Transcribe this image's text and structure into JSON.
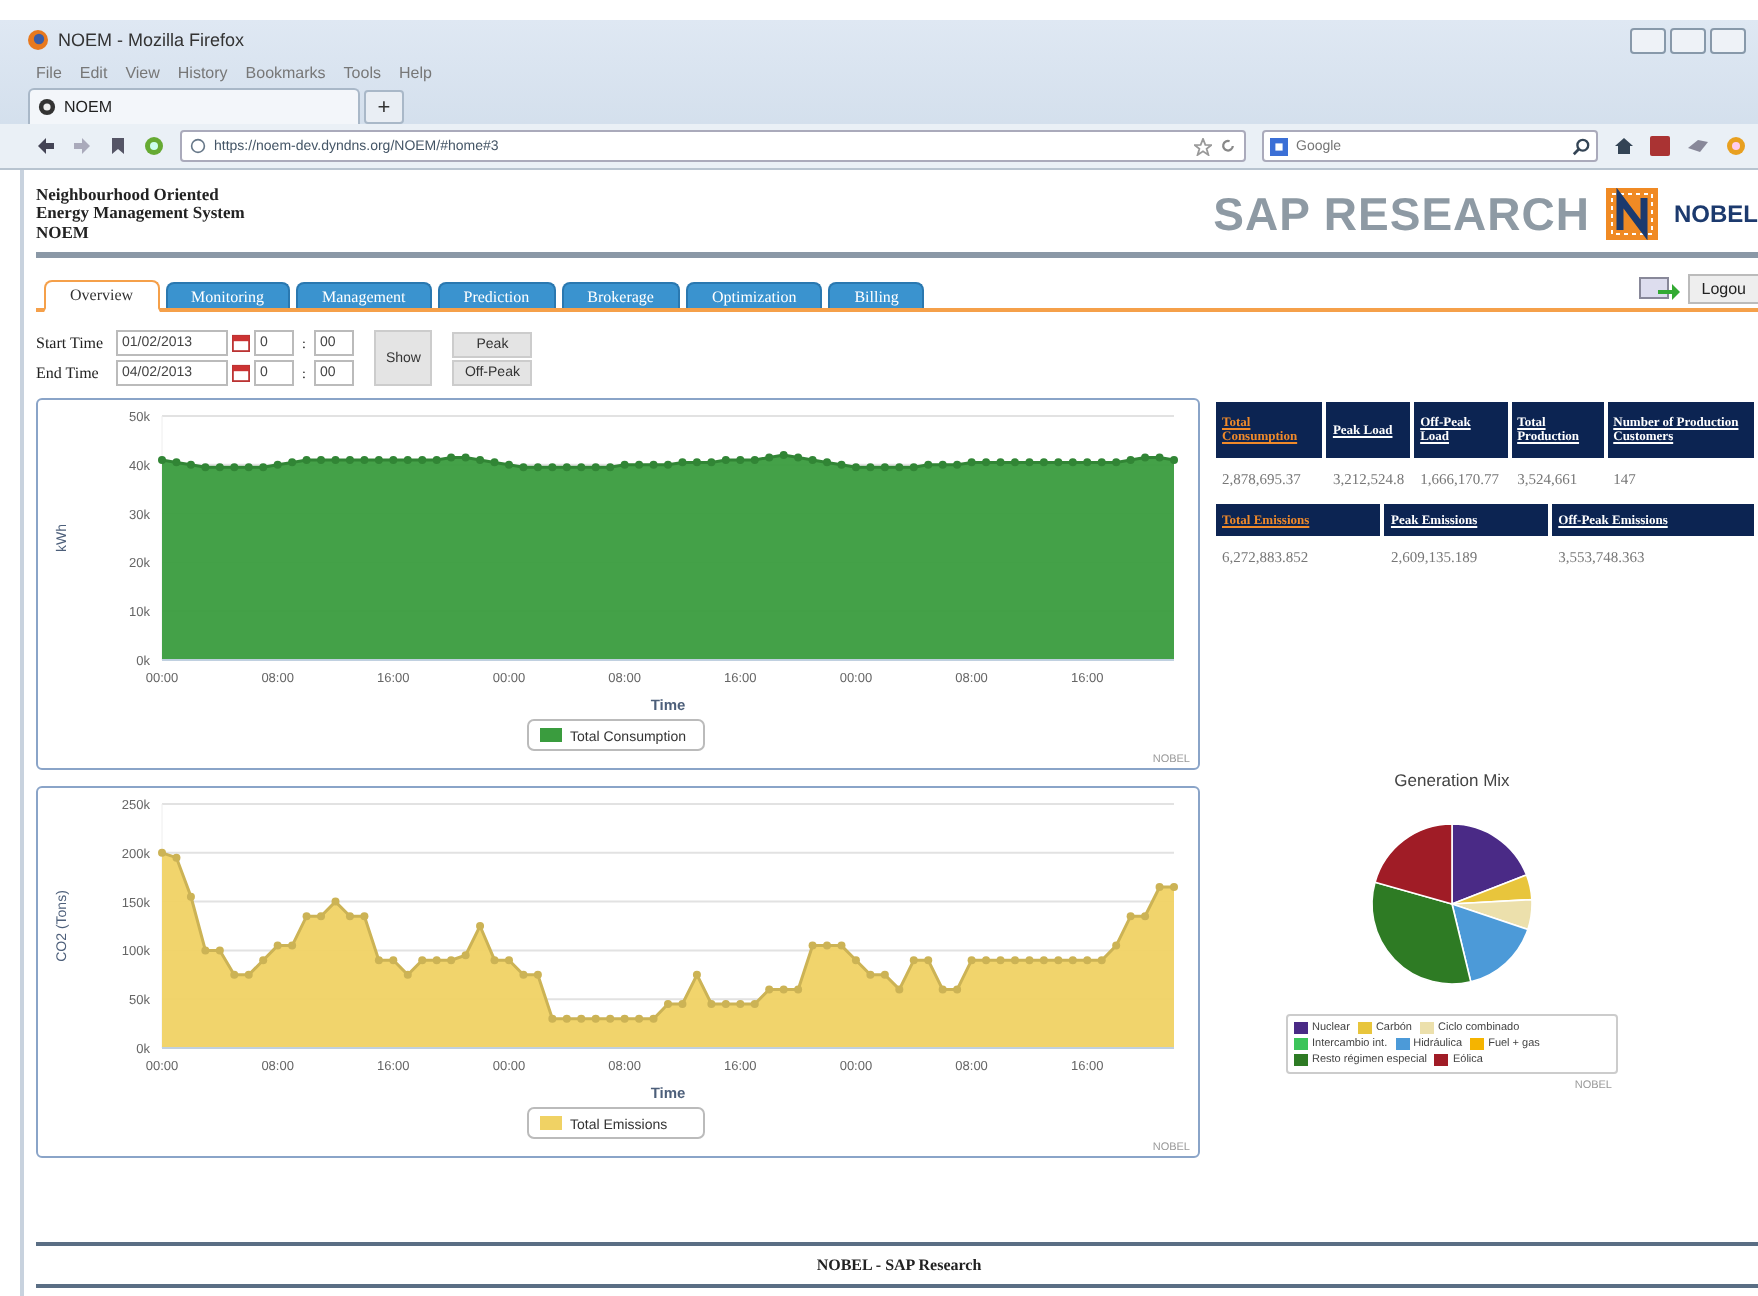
{
  "browser": {
    "title": "NOEM - Mozilla Firefox",
    "menu": [
      "File",
      "Edit",
      "View",
      "History",
      "Bookmarks",
      "Tools",
      "Help"
    ],
    "tab": {
      "label": "NOEM"
    },
    "new_tab": "+",
    "url": "https://noem-dev.dyndns.org/NOEM/#home#3",
    "search": {
      "placeholder": "Google"
    }
  },
  "header": {
    "title_lines": [
      "Neighbourhood Oriented",
      "Energy Management System",
      "NOEM"
    ],
    "logo_text": "SAP RESEARCH",
    "partner_logo": "NOBEL"
  },
  "tabs": [
    {
      "label": "Overview",
      "selected": true
    },
    {
      "label": "Monitoring",
      "selected": false
    },
    {
      "label": "Management",
      "selected": false
    },
    {
      "label": "Prediction",
      "selected": false
    },
    {
      "label": "Brokerage",
      "selected": false
    },
    {
      "label": "Optimization",
      "selected": false
    },
    {
      "label": "Billing",
      "selected": false
    }
  ],
  "logout": "Logou",
  "filters": [
    {
      "label": "Start Time",
      "date": "01/02/2013",
      "hour": "0",
      "separator": ":",
      "minute": "00"
    },
    {
      "label": "End Time",
      "date": "04/02/2013",
      "hour": "0",
      "separator": ":",
      "minute": "00"
    }
  ],
  "show_button": "Show",
  "peak_buttons": [
    "Peak",
    "Off-Peak"
  ],
  "charts": [
    {
      "credit": "NOBEL",
      "chart_data": {
        "type": "area",
        "xlabel": "Time",
        "ylabel": "kWh",
        "grid": true,
        "legend": true,
        "x": [
          "2013-02-01T00:00",
          "2013-02-01T01:00",
          "2013-02-01T02:00",
          "2013-02-01T03:00",
          "2013-02-01T04:00",
          "2013-02-01T05:00",
          "2013-02-01T06:00",
          "2013-02-01T07:00",
          "2013-02-01T08:00",
          "2013-02-01T09:00",
          "2013-02-01T10:00",
          "2013-02-01T11:00",
          "2013-02-01T12:00",
          "2013-02-01T13:00",
          "2013-02-01T14:00",
          "2013-02-01T15:00",
          "2013-02-01T16:00",
          "2013-02-01T17:00",
          "2013-02-01T18:00",
          "2013-02-01T19:00",
          "2013-02-01T20:00",
          "2013-02-01T21:00",
          "2013-02-01T22:00",
          "2013-02-01T23:00",
          "2013-02-02T00:00",
          "2013-02-02T01:00",
          "2013-02-02T02:00",
          "2013-02-02T03:00",
          "2013-02-02T04:00",
          "2013-02-02T05:00",
          "2013-02-02T06:00",
          "2013-02-02T07:00",
          "2013-02-02T08:00",
          "2013-02-02T09:00",
          "2013-02-02T10:00",
          "2013-02-02T11:00",
          "2013-02-02T12:00",
          "2013-02-02T13:00",
          "2013-02-02T14:00",
          "2013-02-02T15:00",
          "2013-02-02T16:00",
          "2013-02-02T17:00",
          "2013-02-02T18:00",
          "2013-02-02T19:00",
          "2013-02-02T20:00",
          "2013-02-02T21:00",
          "2013-02-02T22:00",
          "2013-02-02T23:00",
          "2013-02-03T00:00",
          "2013-02-03T01:00",
          "2013-02-03T02:00",
          "2013-02-03T03:00",
          "2013-02-03T04:00",
          "2013-02-03T05:00",
          "2013-02-03T06:00",
          "2013-02-03T07:00",
          "2013-02-03T08:00",
          "2013-02-03T09:00",
          "2013-02-03T10:00",
          "2013-02-03T11:00",
          "2013-02-03T12:00",
          "2013-02-03T13:00",
          "2013-02-03T14:00",
          "2013-02-03T15:00",
          "2013-02-03T16:00",
          "2013-02-03T17:00",
          "2013-02-03T18:00",
          "2013-02-03T19:00",
          "2013-02-03T20:00",
          "2013-02-03T21:00",
          "2013-02-03T22:00"
        ],
        "xlim": [
          "2013-02-01T00:00",
          "2013-02-03T22:00"
        ],
        "ylim": [
          0,
          50000
        ],
        "yticks": [
          {
            "value": 0,
            "label": "0k"
          },
          {
            "value": 10000,
            "label": "10k"
          },
          {
            "value": 20000,
            "label": "20k"
          },
          {
            "value": 30000,
            "label": "30k"
          },
          {
            "value": 40000,
            "label": "40k"
          },
          {
            "value": 50000,
            "label": "50k"
          }
        ],
        "xticks": [
          {
            "value": "2013-02-01T00:00",
            "label": "00:00"
          },
          {
            "value": "2013-02-01T08:00",
            "label": "08:00"
          },
          {
            "value": "2013-02-01T16:00",
            "label": "16:00"
          },
          {
            "value": "2013-02-02T00:00",
            "label": "00:00"
          },
          {
            "value": "2013-02-02T08:00",
            "label": "08:00"
          },
          {
            "value": "2013-02-02T16:00",
            "label": "16:00"
          },
          {
            "value": "2013-02-03T00:00",
            "label": "00:00"
          },
          {
            "value": "2013-02-03T08:00",
            "label": "08:00"
          },
          {
            "value": "2013-02-03T16:00",
            "label": "16:00"
          }
        ],
        "series": [
          {
            "name": "Total Consumption",
            "color": "#3a9c3e",
            "values": [
              41000,
              40500,
              40000,
              39500,
              39500,
              39500,
              39500,
              39500,
              40000,
              40500,
              41000,
              41000,
              41000,
              41000,
              41000,
              41000,
              41000,
              41000,
              41000,
              41000,
              41500,
              41500,
              41000,
              40500,
              40000,
              39500,
              39500,
              39500,
              39500,
              39500,
              39500,
              39500,
              40000,
              40000,
              40000,
              40000,
              40500,
              40500,
              40500,
              41000,
              41000,
              41000,
              41500,
              42000,
              41500,
              41000,
              40500,
              40000,
              39500,
              39500,
              39500,
              39500,
              39500,
              40000,
              40000,
              40000,
              40500,
              40500,
              40500,
              40500,
              40500,
              40500,
              40500,
              40500,
              40500,
              40500,
              40500,
              41000,
              41500,
              41500,
              41000
            ]
          }
        ]
      }
    },
    {
      "credit": "NOBEL",
      "chart_data": {
        "type": "area",
        "xlabel": "Time",
        "ylabel": "CO2 (Tons)",
        "grid": true,
        "legend": true,
        "x": [
          "2013-02-01T00:00",
          "2013-02-01T01:00",
          "2013-02-01T02:00",
          "2013-02-01T03:00",
          "2013-02-01T04:00",
          "2013-02-01T05:00",
          "2013-02-01T06:00",
          "2013-02-01T07:00",
          "2013-02-01T08:00",
          "2013-02-01T09:00",
          "2013-02-01T10:00",
          "2013-02-01T11:00",
          "2013-02-01T12:00",
          "2013-02-01T13:00",
          "2013-02-01T14:00",
          "2013-02-01T15:00",
          "2013-02-01T16:00",
          "2013-02-01T17:00",
          "2013-02-01T18:00",
          "2013-02-01T19:00",
          "2013-02-01T20:00",
          "2013-02-01T21:00",
          "2013-02-01T22:00",
          "2013-02-01T23:00",
          "2013-02-02T00:00",
          "2013-02-02T01:00",
          "2013-02-02T02:00",
          "2013-02-02T03:00",
          "2013-02-02T04:00",
          "2013-02-02T05:00",
          "2013-02-02T06:00",
          "2013-02-02T07:00",
          "2013-02-02T08:00",
          "2013-02-02T09:00",
          "2013-02-02T10:00",
          "2013-02-02T11:00",
          "2013-02-02T12:00",
          "2013-02-02T13:00",
          "2013-02-02T14:00",
          "2013-02-02T15:00",
          "2013-02-02T16:00",
          "2013-02-02T17:00",
          "2013-02-02T18:00",
          "2013-02-02T19:00",
          "2013-02-02T20:00",
          "2013-02-02T21:00",
          "2013-02-02T22:00",
          "2013-02-02T23:00",
          "2013-02-03T00:00",
          "2013-02-03T01:00",
          "2013-02-03T02:00",
          "2013-02-03T03:00",
          "2013-02-03T04:00",
          "2013-02-03T05:00",
          "2013-02-03T06:00",
          "2013-02-03T07:00",
          "2013-02-03T08:00",
          "2013-02-03T09:00",
          "2013-02-03T10:00",
          "2013-02-03T11:00",
          "2013-02-03T12:00",
          "2013-02-03T13:00",
          "2013-02-03T14:00",
          "2013-02-03T15:00",
          "2013-02-03T16:00",
          "2013-02-03T17:00",
          "2013-02-03T18:00",
          "2013-02-03T19:00",
          "2013-02-03T20:00",
          "2013-02-03T21:00",
          "2013-02-03T22:00"
        ],
        "xlim": [
          "2013-02-01T00:00",
          "2013-02-03T22:00"
        ],
        "ylim": [
          0,
          250000
        ],
        "yticks": [
          {
            "value": 0,
            "label": "0k"
          },
          {
            "value": 50000,
            "label": "50k"
          },
          {
            "value": 100000,
            "label": "100k"
          },
          {
            "value": 150000,
            "label": "150k"
          },
          {
            "value": 200000,
            "label": "200k"
          },
          {
            "value": 250000,
            "label": "250k"
          }
        ],
        "xticks": [
          {
            "value": "2013-02-01T00:00",
            "label": "00:00"
          },
          {
            "value": "2013-02-01T08:00",
            "label": "08:00"
          },
          {
            "value": "2013-02-01T16:00",
            "label": "16:00"
          },
          {
            "value": "2013-02-02T00:00",
            "label": "00:00"
          },
          {
            "value": "2013-02-02T08:00",
            "label": "08:00"
          },
          {
            "value": "2013-02-02T16:00",
            "label": "16:00"
          },
          {
            "value": "2013-02-03T00:00",
            "label": "00:00"
          },
          {
            "value": "2013-02-03T08:00",
            "label": "08:00"
          },
          {
            "value": "2013-02-03T16:00",
            "label": "16:00"
          }
        ],
        "series": [
          {
            "name": "Total Emissions",
            "color": "#f0d264",
            "values": [
              200000,
              195000,
              155000,
              100000,
              100000,
              75000,
              75000,
              90000,
              105000,
              105000,
              135000,
              135000,
              150000,
              135000,
              135000,
              90000,
              90000,
              75000,
              90000,
              90000,
              90000,
              95000,
              125000,
              90000,
              90000,
              75000,
              75000,
              30000,
              30000,
              30000,
              30000,
              30000,
              30000,
              30000,
              30000,
              45000,
              45000,
              75000,
              45000,
              45000,
              45000,
              45000,
              60000,
              60000,
              60000,
              105000,
              105000,
              105000,
              90000,
              75000,
              75000,
              60000,
              90000,
              90000,
              60000,
              60000,
              90000,
              90000,
              90000,
              90000,
              90000,
              90000,
              90000,
              90000,
              90000,
              90000,
              105000,
              135000,
              135000,
              165000,
              165000
            ]
          }
        ]
      }
    }
  ],
  "summary_tables": [
    {
      "columns": [
        {
          "label": "Total Consumption",
          "highlighted": true
        },
        {
          "label": "Peak Load",
          "highlighted": false
        },
        {
          "label": "Off-Peak Load",
          "highlighted": false
        },
        {
          "label": "Total Production",
          "highlighted": false
        },
        {
          "label": "Number of Production Customers",
          "highlighted": false
        }
      ],
      "values": [
        "2,878,695.37",
        "3,212,524.8",
        "1,666,170.77",
        "3,524,661",
        "147"
      ]
    },
    {
      "columns": [
        {
          "label": "Total Emissions",
          "highlighted": true
        },
        {
          "label": "Peak Emissions",
          "highlighted": false
        },
        {
          "label": "Off-Peak Emissions",
          "highlighted": false
        }
      ],
      "values": [
        "6,272,883.852",
        "2,609,135.189",
        "3,553,748.363"
      ]
    }
  ],
  "generation_mix": {
    "credit": "NOBEL",
    "chart_data": {
      "type": "pie",
      "title": "Generation Mix",
      "legend": true,
      "categories": [
        "Nuclear",
        "Carbón",
        "Ciclo combinado",
        "Intercambio int.",
        "Hidráulica",
        "Fuel + gas",
        "Resto régimen especial",
        "Eólica"
      ],
      "colors": [
        "#4a2a86",
        "#e8c53c",
        "#ece0ac",
        "#3cc45a",
        "#4c9ad8",
        "#f5b400",
        "#2e7b24",
        "#a01c26"
      ],
      "values": [
        19,
        5,
        6,
        null,
        16,
        0,
        33,
        20.5
      ]
    }
  },
  "footer": "NOBEL - SAP Research"
}
